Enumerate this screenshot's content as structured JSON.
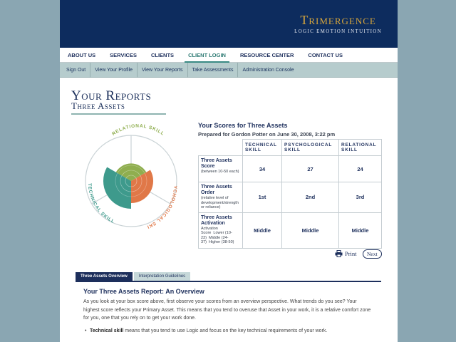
{
  "brand": {
    "name": "Trimergence",
    "tagline": "LOGIC EMOTION INTUITION"
  },
  "main_nav": {
    "items": [
      {
        "label": "ABOUT US"
      },
      {
        "label": "SERVICES"
      },
      {
        "label": "CLIENTS"
      },
      {
        "label": "CLIENT LOGIN",
        "active": true
      },
      {
        "label": "RESOURCE CENTER"
      },
      {
        "label": "CONTACT US"
      }
    ]
  },
  "sub_nav": {
    "items": [
      {
        "label": "Sign Out"
      },
      {
        "label": "View Your Profile"
      },
      {
        "label": "View Your Reports"
      },
      {
        "label": "Take Assessments"
      },
      {
        "label": "Administration Console"
      }
    ]
  },
  "page": {
    "title": "Your Reports",
    "subtitle": "Three Assets"
  },
  "wheel": {
    "labels": {
      "relational": "RELATIONAL SKILL",
      "psychological": "PSYCHOLOGICAL SKILL",
      "technical": "TECHNICAL SKILL"
    },
    "colors": {
      "relational": "#8fae4f",
      "psychological": "#e07848",
      "technical": "#3e9a8c"
    }
  },
  "scores": {
    "title": "Your Scores for Three Assets",
    "prepared_for": "Prepared for Gordon Potter on June 30, 2008, 3:22 pm",
    "columns": [
      "TECHNICAL SKILL",
      "PSYCHOLOGICAL SKILL",
      "RELATIONAL SKILL"
    ],
    "rows": [
      {
        "label": "Three Assets Score",
        "sub": "(between 10-50 each)",
        "values": [
          "34",
          "27",
          "24"
        ]
      },
      {
        "label": "Three Assets Order",
        "sub": "(relative level of development/strength or reliance)",
        "values": [
          "1st",
          "2nd",
          "3rd"
        ]
      },
      {
        "label": "Three Assets Activation",
        "sub": "Activation  Score  Lower (10-23)  Middle (24-37)  Higher (38-50)",
        "values": [
          "Middle",
          "Middle",
          "Middle"
        ]
      }
    ]
  },
  "actions": {
    "print": "Print",
    "next": "Next"
  },
  "tabs": [
    {
      "label": "Three Assets Overview",
      "active": true
    },
    {
      "label": "Interpretation Guidelines",
      "active": false
    }
  ],
  "overview": {
    "title": "Your Three Assets Report: An Overview",
    "body": "As you look at your box score above, first observe your scores from an overview perspective. What trends do you see? Your highest score reflects your Primary Asset. This means that you tend to overuse that Asset in your work, it is a relative comfort zone for you, one that you rely on to get your work done.",
    "bullet_bold": "Technical skill",
    "bullet_text": " means that you tend to use Logic and focus on the key technical requirements of your work."
  }
}
